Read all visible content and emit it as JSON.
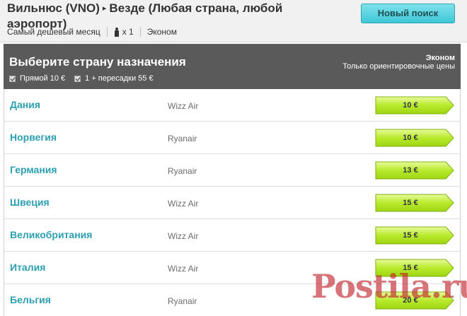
{
  "header": {
    "from": "Вильнюс (VNO)",
    "arrow": "▸",
    "to": "Везде (Любая страна, любой аэропорт)",
    "month": "Самый дешевый месяц",
    "passengers": "x 1",
    "cabin": "Эконом",
    "new_search_label": "Новый поиск"
  },
  "panel": {
    "title": "Выберите страну назначения",
    "cabin_class": "Эконом",
    "note": "Только ориентировочные цены",
    "filters": [
      {
        "label": "Прямой 10 €",
        "checked": true
      },
      {
        "label": "1 + пересадки 55 €",
        "checked": true
      }
    ]
  },
  "results": [
    {
      "country": "Дания",
      "airline": "Wizz Air",
      "price": "10 €"
    },
    {
      "country": "Норвегия",
      "airline": "Ryanair",
      "price": "10 €"
    },
    {
      "country": "Германия",
      "airline": "Ryanair",
      "price": "13 €"
    },
    {
      "country": "Швеция",
      "airline": "Wizz Air",
      "price": "15 €"
    },
    {
      "country": "Великобритания",
      "airline": "Wizz Air",
      "price": "15 €"
    },
    {
      "country": "Италия",
      "airline": "Wizz Air",
      "price": "15 €"
    },
    {
      "country": "Бельгия",
      "airline": "Ryanair",
      "price": "20 €"
    }
  ],
  "watermark": "Postila.ru",
  "colors": {
    "accent_teal": "#2d9fb0",
    "button_cyan": "#3fc7d6",
    "price_green": "#a8e21c",
    "panel_dark": "#5a5a5a"
  }
}
